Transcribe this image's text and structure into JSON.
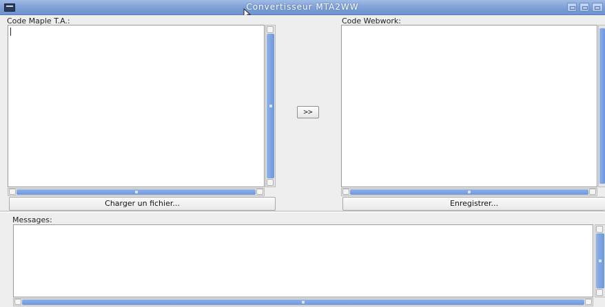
{
  "window": {
    "title": "Convertisseur MTA2WW"
  },
  "left_panel": {
    "label": "Code Maple T.A.:",
    "content": "",
    "load_button_label": "Charger un fichier..."
  },
  "convert_button_label": ">>",
  "right_panel": {
    "label": "Code Webwork:",
    "content": "",
    "save_button_label": "Enregistrer..."
  },
  "messages": {
    "label": "Messages:",
    "content": ""
  },
  "colors": {
    "titlebar": "#7d9fd6",
    "scroll_thumb": "#7ea4e2",
    "panel_bg": "#eeeeee"
  }
}
